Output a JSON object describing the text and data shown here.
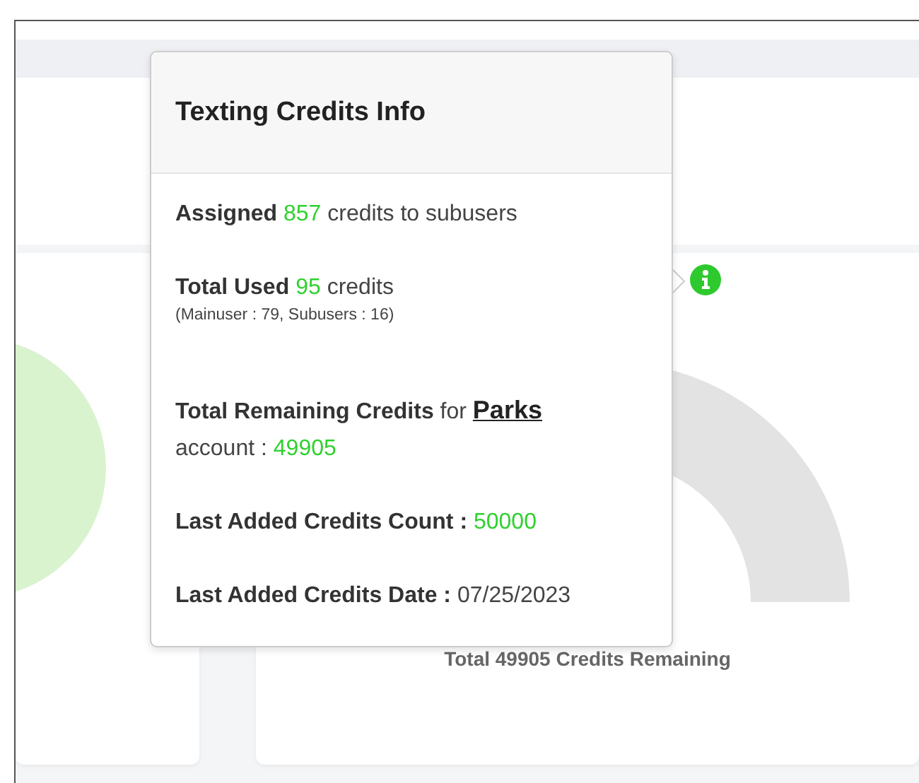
{
  "popover": {
    "title": "Texting Credits Info",
    "lines": [
      {
        "segments": [
          {
            "kind": "label",
            "text": "Assigned"
          },
          {
            "kind": "value",
            "text": "857"
          },
          {
            "kind": "text",
            "text": "credits to subusers"
          }
        ]
      },
      {
        "segments": [
          {
            "kind": "label",
            "text": "Total Used"
          },
          {
            "kind": "value",
            "text": "95"
          },
          {
            "kind": "text",
            "text": "credits"
          }
        ],
        "note": "(Mainuser : 79, Subusers : 16)"
      },
      {
        "segments": [
          {
            "kind": "label",
            "text": "Total Remaining Credits"
          },
          {
            "kind": "text",
            "text": "for"
          },
          {
            "kind": "link",
            "text": "Parks"
          },
          {
            "kind": "text",
            "text": "account :"
          },
          {
            "kind": "value",
            "text": "49905"
          }
        ]
      },
      {
        "segments": [
          {
            "kind": "label",
            "text": "Last Added Credits Count :"
          },
          {
            "kind": "value",
            "text": "50000"
          }
        ]
      },
      {
        "segments": [
          {
            "kind": "label",
            "text": "Last Added Credits Date :"
          },
          {
            "kind": "text",
            "text": "07/25/2023"
          }
        ]
      }
    ]
  },
  "gauge": {
    "caption": "Total 49905 Credits Remaining"
  }
}
